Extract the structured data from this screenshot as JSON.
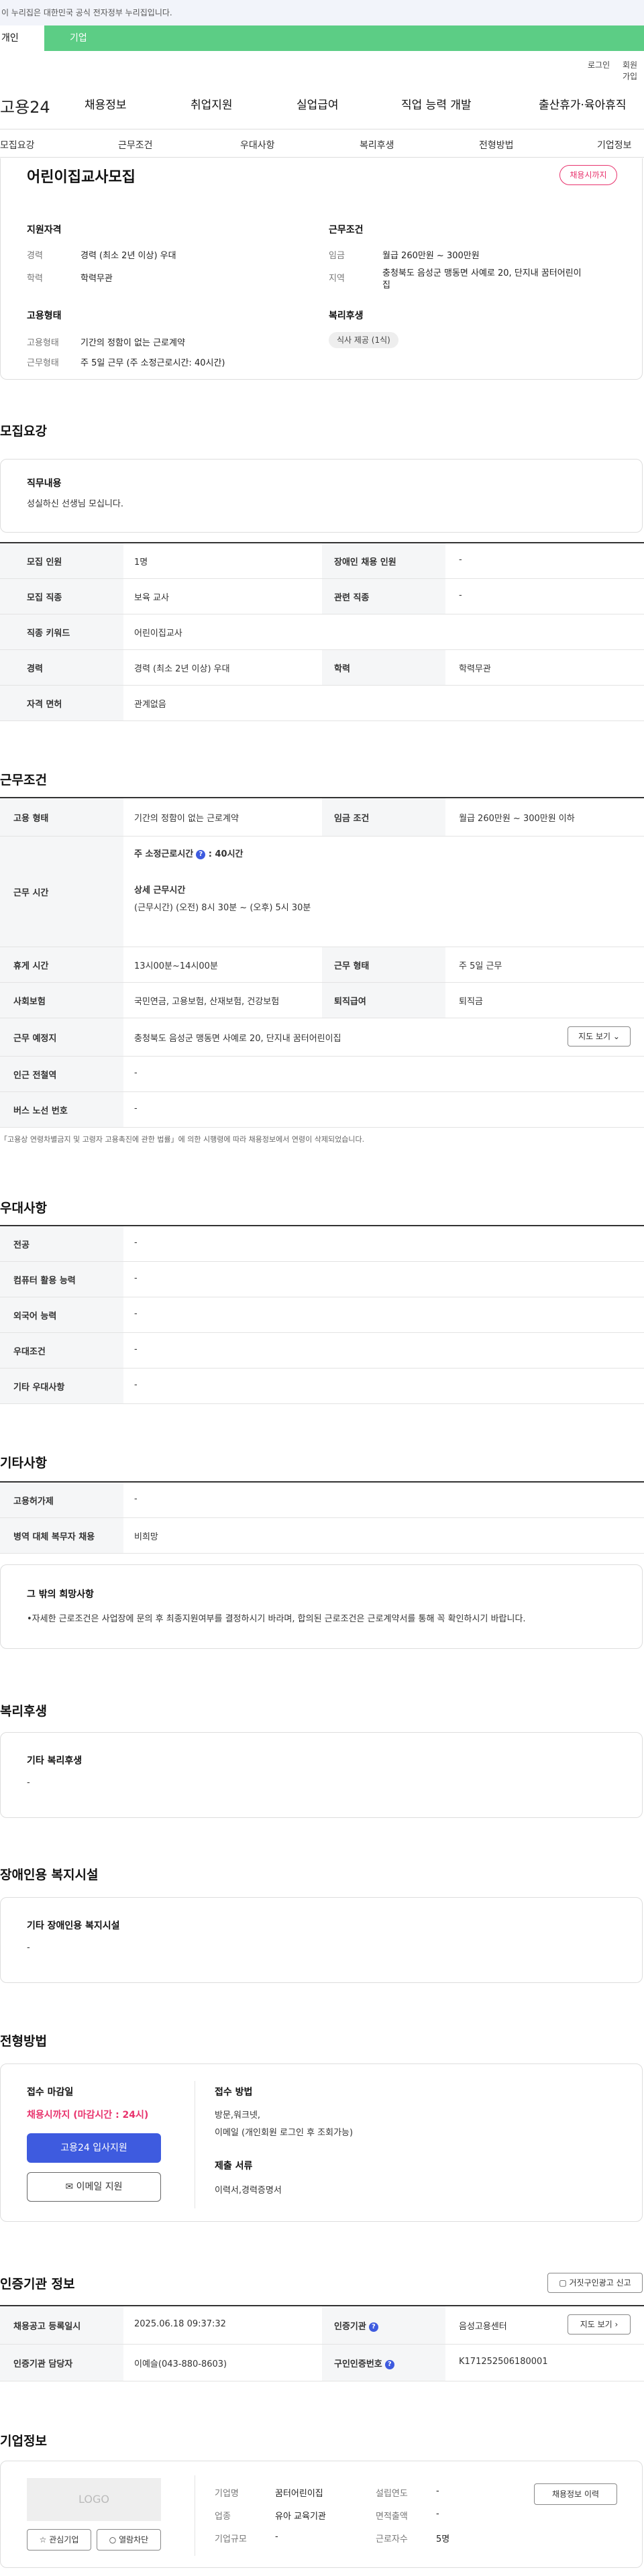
{
  "banner": {
    "text": "이 누리집은 대한민국 공식 전자정부 누리집입니다."
  },
  "user_tabs": {
    "active": "개인",
    "other": "기업"
  },
  "util": {
    "login": "로그인",
    "signup": "회원가입"
  },
  "logo": "고용24",
  "gnb": [
    "채용정보",
    "취업지원",
    "실업급여",
    "직업 능력 개발",
    "출산휴가·육아휴직"
  ],
  "subtabs": [
    "모집요강",
    "근무조건",
    "우대사항",
    "복리후생",
    "전형방법",
    "기업정보"
  ],
  "summary": {
    "title": "어린이집교사모집",
    "deadline_badge": "채용시까지",
    "qual_label": "지원자격",
    "career_k": "경력",
    "career_v": "경력 (최소 2년 이상) 우대",
    "edu_k": "학력",
    "edu_v": "학력무관",
    "cond_label": "근무조건",
    "wage_k": "임금",
    "wage_v": "월급 260만원 ~ 300만원",
    "area_k": "지역",
    "area_v1": "충청북도 음성군 맹동면 사예로 20, 단지내 꿈터어린이",
    "area_v2": "집",
    "emp_label": "고용형태",
    "emptype_k": "고용형태",
    "emptype_v": "기간의 정함이 없는 근로계약",
    "worktype_k": "근무형태",
    "worktype_v": "주 5일 근무 (주 소정근로시간: 40시간)",
    "welfare_label": "복리후생",
    "welfare_chip": "식사 제공 (1식)"
  },
  "recruit": {
    "heading": "모집요강",
    "duty_title": "직무내용",
    "duty_text": "성실하신 선생님 모십니다.",
    "rows": [
      {
        "k1": "모집 인원",
        "v1": "1명",
        "k2": "장애인 채용 인원",
        "v2": "-"
      },
      {
        "k1": "모집 직종",
        "v1": "보육 교사",
        "k2": "관련 직종",
        "v2": "-"
      },
      {
        "k1": "직종 키워드",
        "v1": "어린이집교사"
      },
      {
        "k1": "경력",
        "v1": "경력 (최소 2년 이상) 우대",
        "k2": "학력",
        "v2": "학력무관"
      },
      {
        "k1": "자격 면허",
        "v1": "관계없음"
      }
    ]
  },
  "work": {
    "heading": "근무조건",
    "emp_k": "고용 형태",
    "emp_v": "기간의 정함이 없는 근로계약",
    "wage_k": "임금 조건",
    "wage_v": "월급 260만원 ~ 300만원 이하",
    "time_k": "근무 시간",
    "time_std_label": "주 소정근로시간",
    "time_std_value": ": 40시간",
    "time_detail_label": "상세 근무시간",
    "time_detail_value": "(근무시간) (오전) 8시 30분 ~ (오후) 5시 30분",
    "rest_k": "휴게 시간",
    "rest_v": "13시00분~14시00분",
    "form_k": "근무 형태",
    "form_v": "주 5일 근무",
    "ins_k": "사회보험",
    "ins_v": "국민연금, 고용보험, 산재보험, 건강보험",
    "retire_k": "퇴직급여",
    "retire_v": "퇴직금",
    "place_k": "근무 예정지",
    "place_v": "충청북도 음성군 맹동면 사예로 20, 단지내 꿈터어린이집",
    "map_btn": "지도 보기",
    "station_k": "인근 전철역",
    "station_v": "-",
    "bus_k": "버스 노선 번호",
    "bus_v": "-",
    "footnote": "「고용상 연령차별금지 및 고령자 고용촉진에 관한 법률」에 의한 시행령에 따라 채용정보에서 연령이 삭제되었습니다."
  },
  "pref": {
    "heading": "우대사항",
    "rows": [
      {
        "k": "전공",
        "v": "-"
      },
      {
        "k": "컴퓨터 활용 능력",
        "v": "-"
      },
      {
        "k": "외국어 능력",
        "v": "-"
      },
      {
        "k": "우대조건",
        "v": "-"
      },
      {
        "k": "기타 우대사항",
        "v": "-"
      }
    ]
  },
  "etc": {
    "heading": "기타사항",
    "rows": [
      {
        "k": "고용허가제",
        "v": "-"
      },
      {
        "k": "병역 대체 복무자 채용",
        "v": "비희망"
      }
    ],
    "wish_title": "그 밖의 희망사항",
    "wish_text": "•자세한 근로조건은 사업장에 문의 후 최종지원여부를 결정하시기 바라며, 합의된 근로조건은 근로계약서를 통해 꼭 확인하시기 바랍니다."
  },
  "welfare": {
    "heading": "복리후생",
    "box_title": "기타 복리후생",
    "box_text": "-"
  },
  "disabled": {
    "heading": "장애인용 복지시설",
    "box_title": "기타 장애인용 복지시설",
    "box_text": "-"
  },
  "process": {
    "heading": "전형방법",
    "deadline_label": "접수 마감일",
    "deadline_value": "채용시까지 (마감시간 : 24시)",
    "apply_btn": "고용24 입사지원",
    "email_btn": "이메일 지원",
    "method_label": "접수 방법",
    "method_v1": "방문,워크넷,",
    "method_v2": "이메일 (개인회원 로그인 후 조회가능)",
    "docs_label": "제출 서류",
    "docs_v": "이력서,경력증명서"
  },
  "cert": {
    "heading": "인증기관 정보",
    "report_btn": "거짓구인광고 신고",
    "reg_k": "채용공고 등록일시",
    "reg_v": "2025.06.18 09:37:32",
    "org_k": "인증기관",
    "org_v": "음성고용센터",
    "map_btn": "지도 보기",
    "mgr_k": "인증기관 담당자",
    "mgr_v": "이예슬(043-880-8603)",
    "no_k": "구인인증번호",
    "no_v": "K171252506180001"
  },
  "company": {
    "heading": "기업정보",
    "logo": "LOGO",
    "fav_btn": "관심기업",
    "block_btn": "열람차단",
    "name_k": "기업명",
    "name_v": "꿈터어린이집",
    "year_k": "설립연도",
    "year_v": "-",
    "industry_k": "업종",
    "industry_v": "유아 교육기관",
    "area_k": "면적출액",
    "area_v": "-",
    "size_k": "기업규모",
    "size_v": "-",
    "staff_k": "근로자수",
    "staff_v": "5명",
    "jobs_btn": "채용정보 이력"
  }
}
